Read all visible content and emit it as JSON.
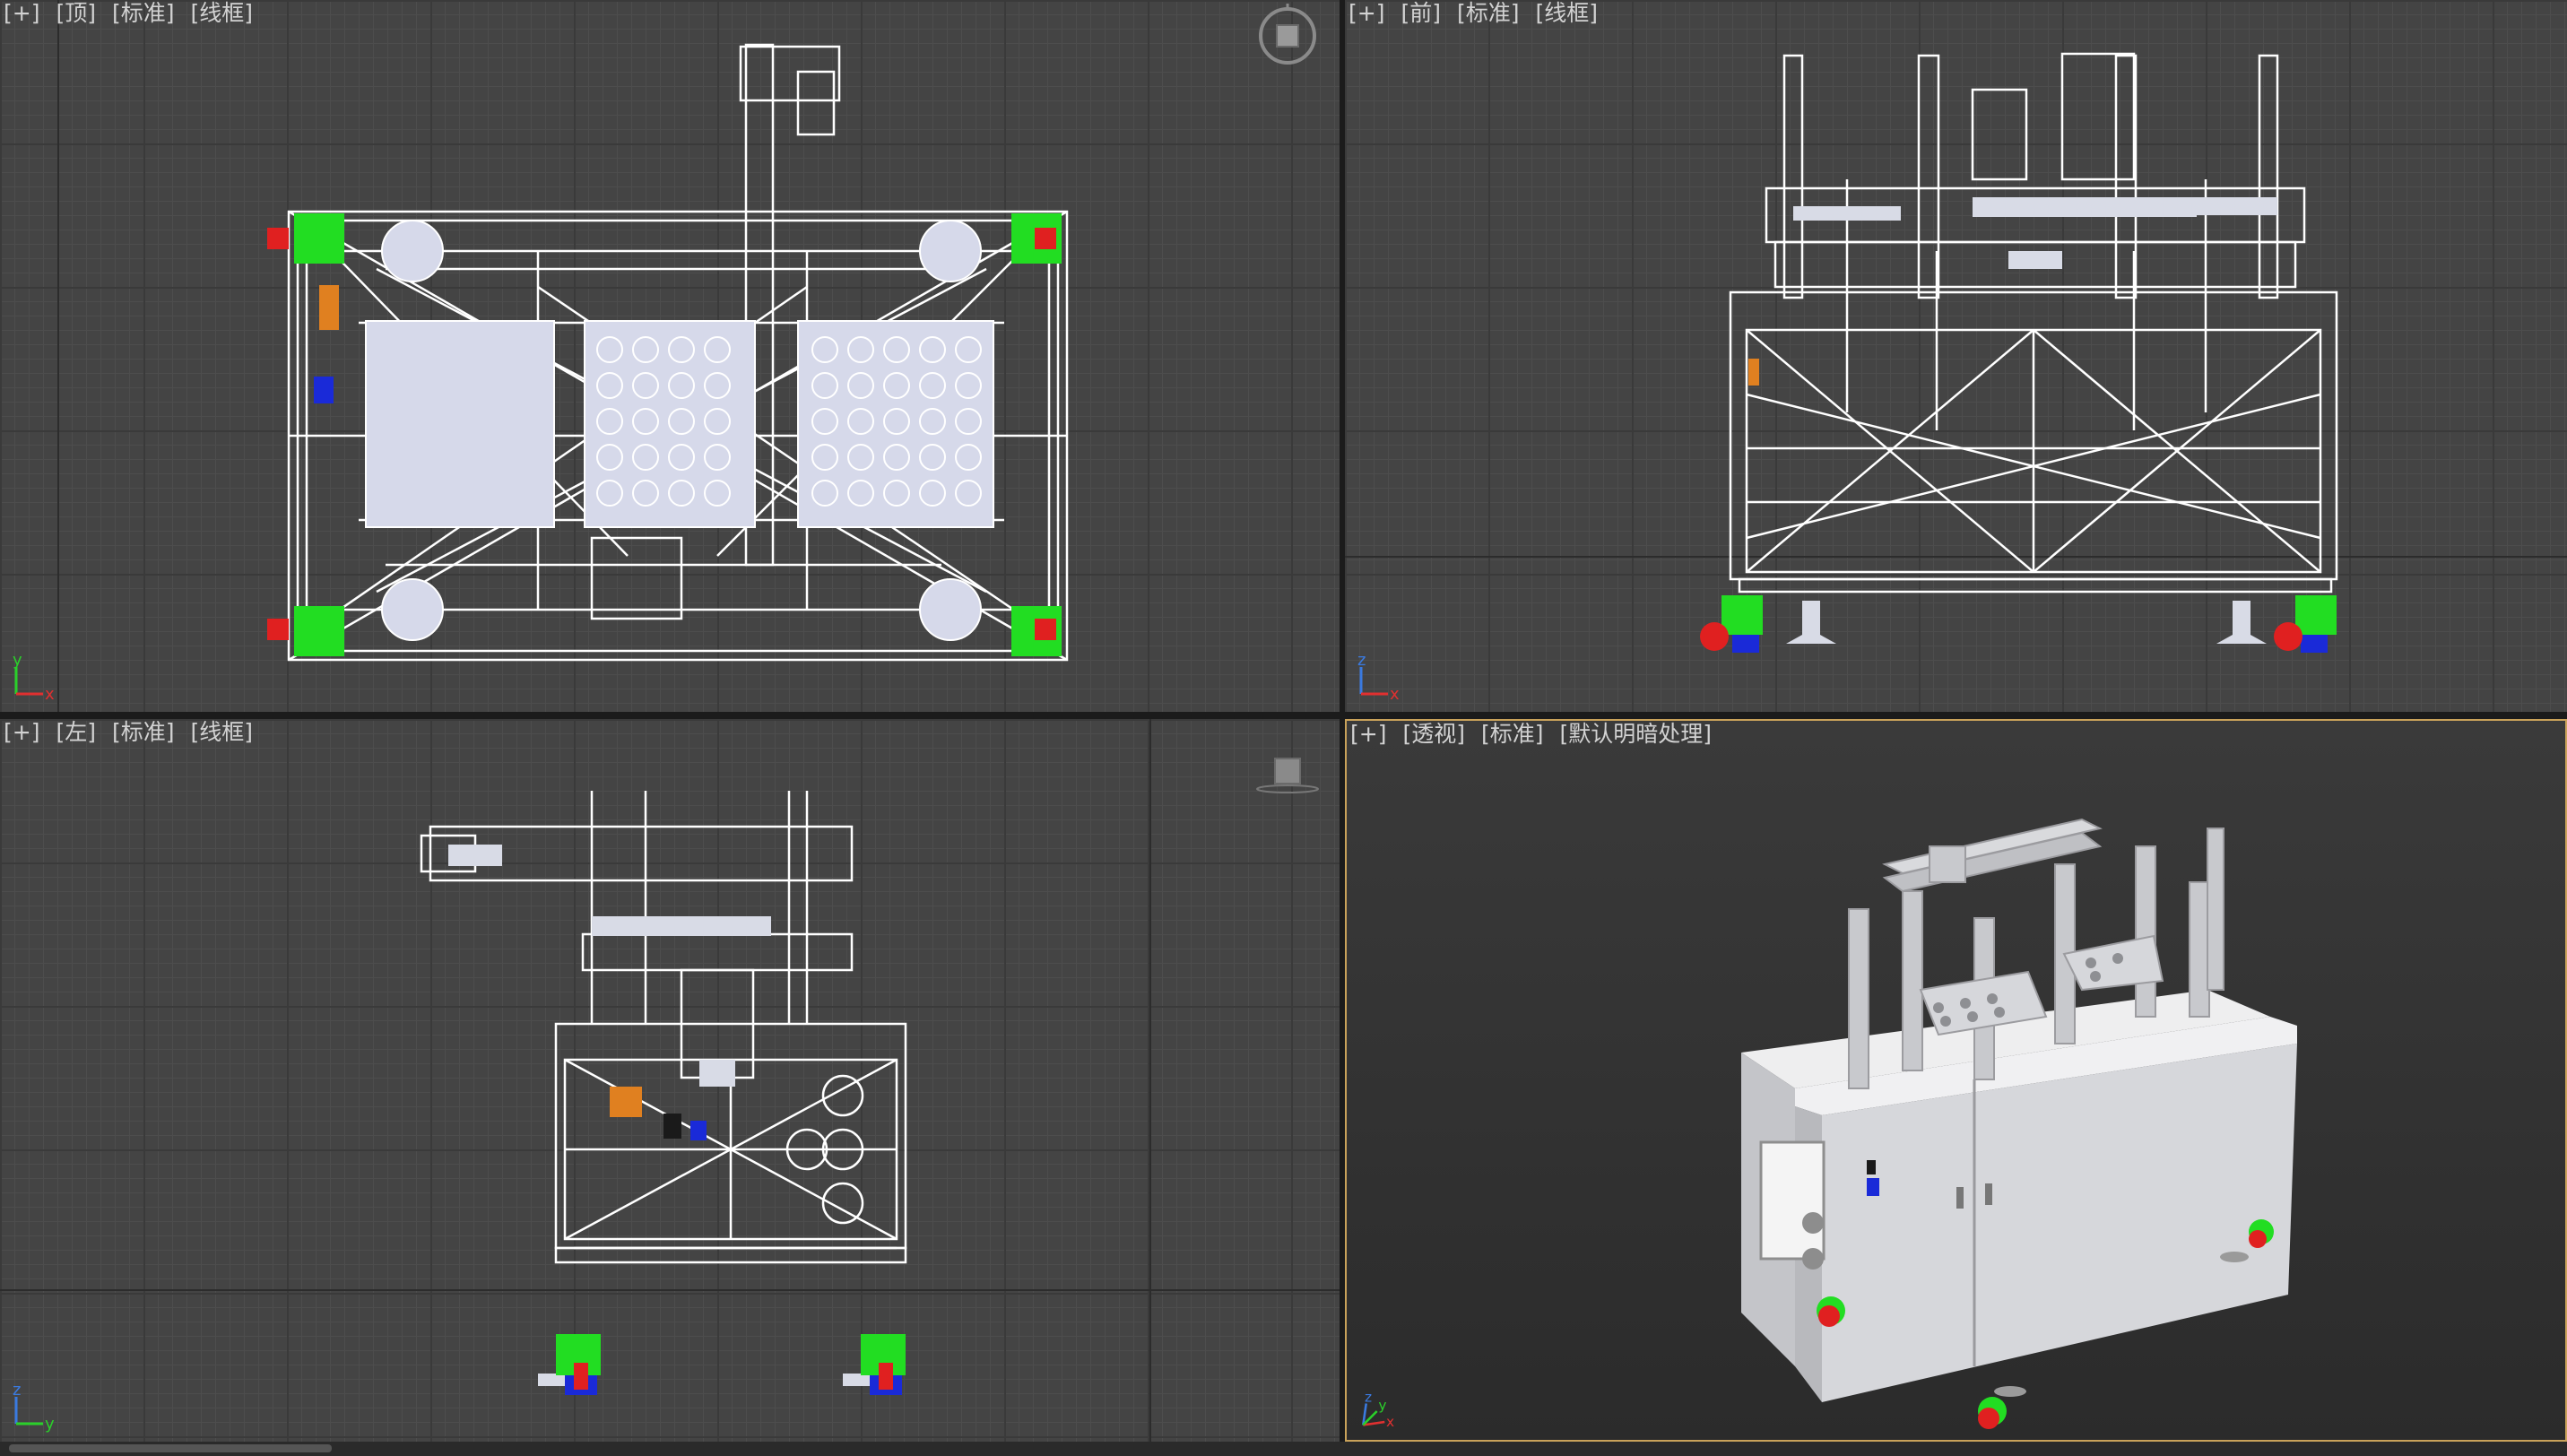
{
  "viewports": [
    {
      "id": "top",
      "labels": [
        "[+]",
        "[顶]",
        "[标准]",
        "[线框]"
      ]
    },
    {
      "id": "front",
      "labels": [
        "[+]",
        "[前]",
        "[标准]",
        "[线框]"
      ]
    },
    {
      "id": "left",
      "labels": [
        "[+]",
        "[左]",
        "[标准]",
        "[线框]"
      ]
    },
    {
      "id": "perspective",
      "labels": [
        "[+]",
        "[透视]",
        "[标准]",
        "[默认明暗处理]"
      ]
    }
  ],
  "axes": {
    "x": "x",
    "y": "y",
    "z": "z"
  },
  "colors": {
    "viewport_bg": "#444444",
    "grid_major": "#3a3a3a",
    "active_border": "#c9a25a",
    "wire": "#ffffff",
    "solid": "#d8dbe6",
    "caster_green": "#22dd22",
    "caster_red": "#e02020",
    "caster_blue": "#1a2ad8",
    "accent_orange": "#e08020"
  },
  "icons": {
    "viewcube": "viewcube-icon",
    "axis_gizmo": "axis-gizmo-icon"
  }
}
